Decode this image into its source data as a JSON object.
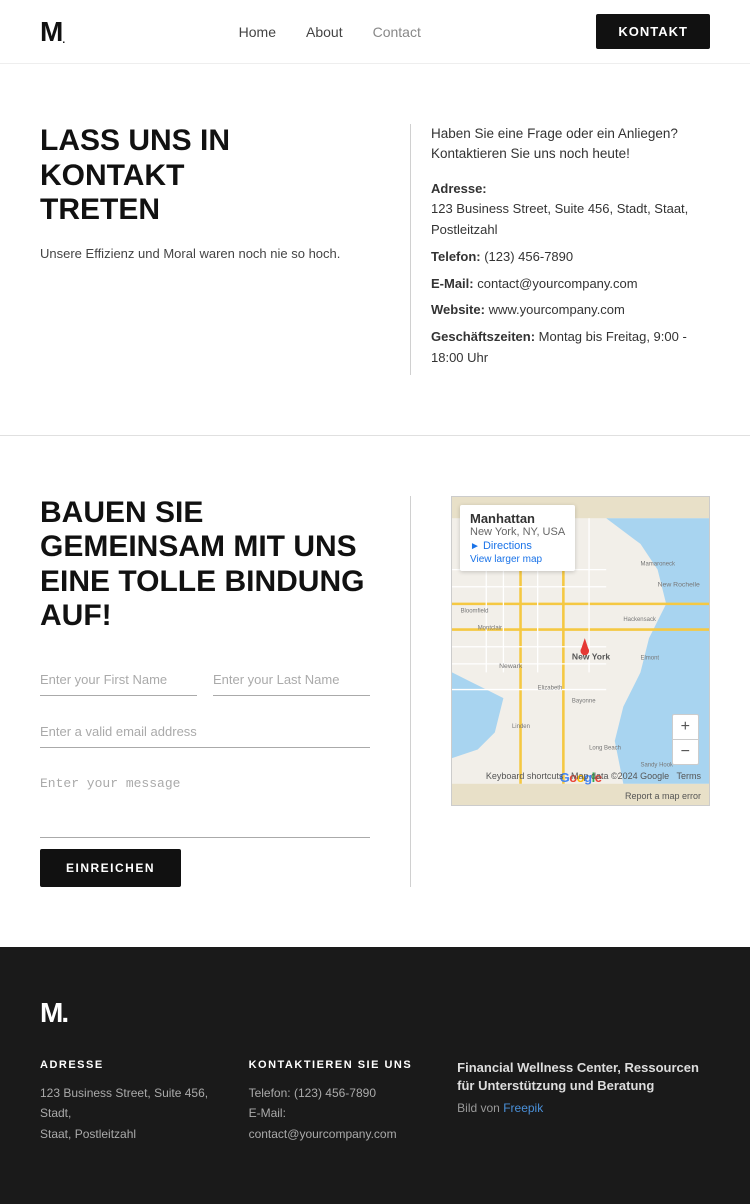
{
  "nav": {
    "logo": "M.",
    "links": [
      {
        "label": "Home",
        "id": "home"
      },
      {
        "label": "About",
        "id": "about"
      },
      {
        "label": "Contact",
        "id": "contact"
      }
    ],
    "cta_label": "KONTAKT"
  },
  "contact_section": {
    "title_line1": "LASS UNS IN KONTAKT",
    "title_line2": "TRETEN",
    "subtitle": "Unsere Effizienz und Moral waren noch nie so hoch.",
    "intro": "Haben Sie eine Frage oder ein Anliegen? Kontaktieren Sie uns noch heute!",
    "address_label": "Adresse:",
    "address_value": "123 Business Street, Suite 456, Stadt, Staat, Postleitzahl",
    "telefon_label": "Telefon:",
    "telefon_value": "(123) 456-7890",
    "email_label": "E-Mail:",
    "email_value": "contact@yourcompany.com",
    "website_label": "Website:",
    "website_value": "www.yourcompany.com",
    "hours_label": "Geschäftszeiten:",
    "hours_value": "Montag bis Freitag, 9:00 - 18:00 Uhr"
  },
  "form_section": {
    "title_line1": "BAUEN SIE",
    "title_line2": "GEMEINSAM MIT UNS",
    "title_line3": "EINE TOLLE BINDUNG",
    "title_line4": "AUF!",
    "first_name_placeholder": "Enter your First Name",
    "last_name_placeholder": "Enter your Last Name",
    "email_placeholder": "Enter a valid email address",
    "message_placeholder": "Enter your message",
    "submit_label": "EINREICHEN",
    "map_place": "Manhattan",
    "map_place_sub": "New York, NY, USA",
    "map_directions": "Directions",
    "map_larger": "View larger map",
    "map_zoom_plus": "+",
    "map_zoom_minus": "−",
    "map_keyboard": "Keyboard shortcuts",
    "map_data": "Map data ©2024 Google",
    "map_terms": "Terms",
    "map_report": "Report a map error"
  },
  "footer": {
    "logo": "M.",
    "address_title": "ADRESSE",
    "address_line1": "123 Business Street, Suite 456, Stadt,",
    "address_line2": "Staat, Postleitzahl",
    "contact_title": "KONTAKTIEREN SIE UNS",
    "contact_phone": "Telefon: (123) 456-7890",
    "contact_email": "E-Mail: contact@yourcompany.com",
    "promo_title": "Financial Wellness Center, Ressourcen für Unterstützung und Beratung",
    "promo_sub": "Bild von ",
    "freepik_label": "Freepik"
  }
}
